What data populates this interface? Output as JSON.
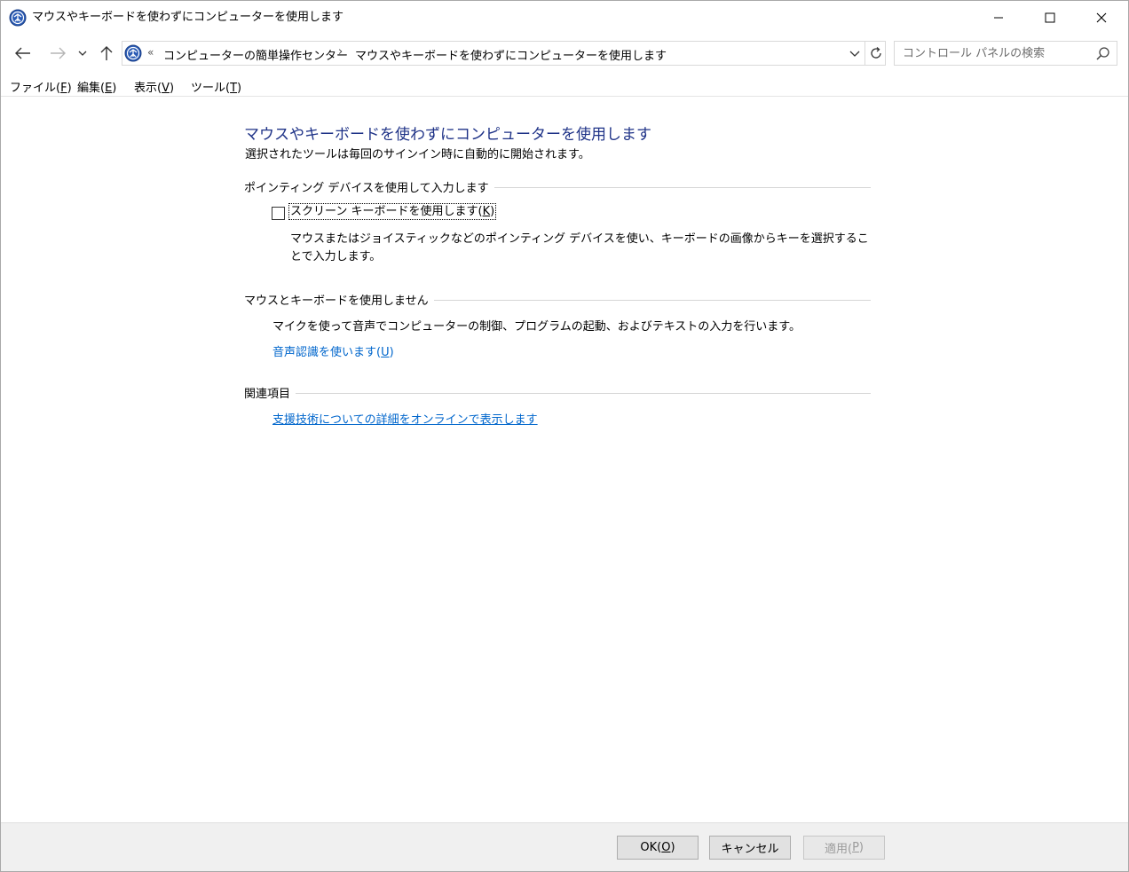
{
  "window": {
    "title": "マウスやキーボードを使わずにコンピューターを使用します",
    "controls": {
      "minimize": "minimize-icon",
      "maximize": "maximize-icon",
      "close": "close-icon"
    }
  },
  "address": {
    "overflow": "«",
    "breadcrumb": [
      "コンピューターの簡単操作センター",
      "マウスやキーボードを使わずにコンピューターを使用します"
    ],
    "separator": "›"
  },
  "search": {
    "placeholder": "コントロール パネルの検索"
  },
  "menu": {
    "file": {
      "text": "ファイル(",
      "key": "F",
      "close": ")"
    },
    "edit": {
      "text": "編集(",
      "key": "E",
      "close": ")"
    },
    "view": {
      "text": "表示(",
      "key": "V",
      "close": ")"
    },
    "tools": {
      "text": "ツール(",
      "key": "T",
      "close": ")"
    }
  },
  "main": {
    "title": "マウスやキーボードを使わずにコンピューターを使用します",
    "subtitle": "選択されたツールは毎回のサインイン時に自動的に開始されます。",
    "pointing": {
      "heading": "ポインティング デバイスを使用して入力します",
      "checkbox": {
        "text": "スクリーン キーボードを使用します(",
        "key": "K",
        "close": ")",
        "checked": false
      },
      "description": "マウスまたはジョイスティックなどのポインティング デバイスを使い、キーボードの画像からキーを選択することで入力します。"
    },
    "nomouse": {
      "heading": "マウスとキーボードを使用しません",
      "text": "マイクを使って音声でコンピューターの制御、プログラムの起動、およびテキストの入力を行います。",
      "link": {
        "text": "音声認識を使います(",
        "key": "U",
        "close": ")"
      }
    },
    "related": {
      "heading": "関連項目",
      "link": "支援技術についての詳細をオンラインで表示します"
    }
  },
  "buttons": {
    "ok": {
      "text": "OK(",
      "key": "O",
      "close": ")"
    },
    "cancel": "キャンセル",
    "apply": {
      "text": "適用(",
      "key": "P",
      "close": ")"
    }
  },
  "colors": {
    "title_blue": "#1e3287",
    "link_blue": "#0066cc"
  }
}
